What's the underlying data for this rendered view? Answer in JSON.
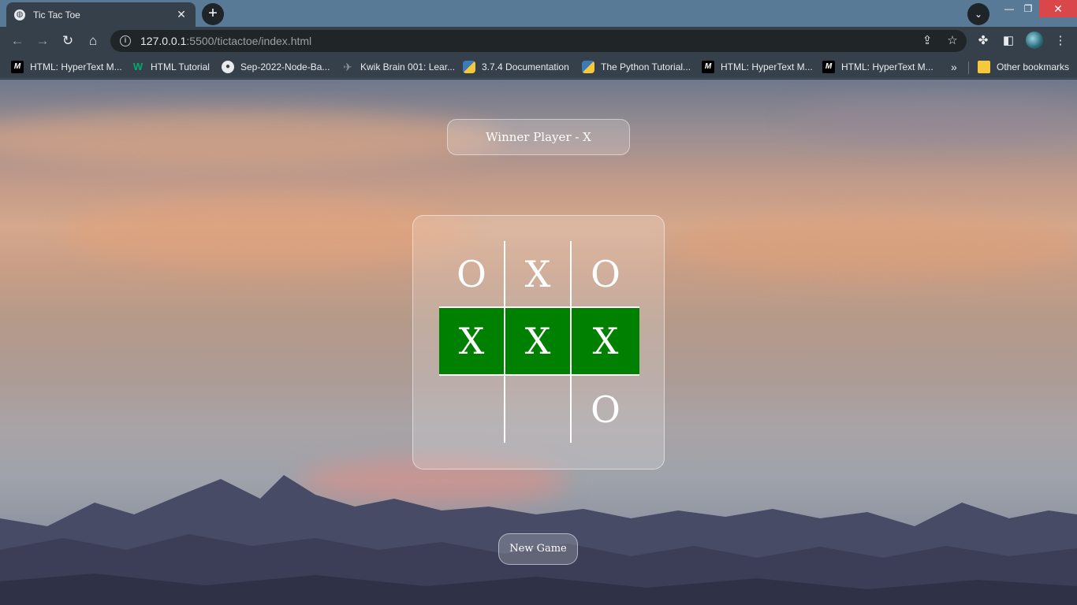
{
  "browser": {
    "tab_title": "Tic Tac Toe",
    "url_host": "127.0.0.1",
    "url_path": ":5500/tictactoe/index.html",
    "bookmarks": [
      {
        "label": "HTML: HyperText M...",
        "icon": "mdn-icon"
      },
      {
        "label": "HTML Tutorial",
        "icon": "w3schools-icon"
      },
      {
        "label": "Sep-2022-Node-Ba...",
        "icon": "github-icon"
      },
      {
        "label": "Kwik Brain 001: Lear...",
        "icon": "kwik-icon"
      },
      {
        "label": "3.7.4 Documentation",
        "icon": "python-icon"
      },
      {
        "label": "The Python Tutorial...",
        "icon": "python-icon"
      },
      {
        "label": "HTML: HyperText M...",
        "icon": "mdn-icon"
      },
      {
        "label": "HTML: HyperText M...",
        "icon": "mdn-icon"
      }
    ],
    "overflow_label": "»",
    "other_bookmarks": "Other bookmarks"
  },
  "game": {
    "status": "Winner Player - X",
    "board": [
      "O",
      "X",
      "O",
      "X",
      "X",
      "X",
      "",
      "",
      "O"
    ],
    "winning_cells": [
      3,
      4,
      5
    ],
    "win_color": "#008000",
    "new_game_label": "New Game"
  }
}
